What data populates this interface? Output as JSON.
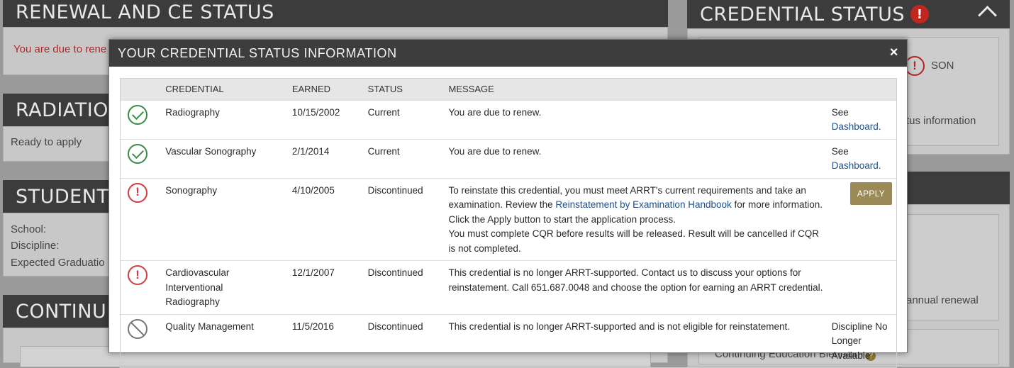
{
  "background": {
    "renewal_title": "RENEWAL AND CE STATUS",
    "renewal_text": "You are due to rene",
    "radiation_title": "RADIATIO",
    "radiation_text": "Ready to apply",
    "student_title": "STUDENT",
    "student_school": "School:",
    "student_discipline": "Discipline:",
    "student_graduation": "Expected Graduatio",
    "continuing_title": "CONTINU",
    "credential_status_title": "CREDENTIAL STATUS",
    "credential_status_alert": "!",
    "right_son": "SON",
    "right_status_info": "tus information",
    "right_annual_renewal": "annual renewal",
    "right_ce_biennium": "Continuing Education Biennium"
  },
  "modal": {
    "title": "YOUR CREDENTIAL STATUS INFORMATION",
    "close": "×",
    "columns": [
      "CREDENTIAL",
      "EARNED",
      "STATUS",
      "MESSAGE"
    ],
    "rows": [
      {
        "icon": "check-circle-icon",
        "credential": "Radiography",
        "earned": "10/15/2002",
        "status": "Current",
        "message": "You are due to renew.",
        "action_prefix": "See ",
        "action_link": "Dashboard."
      },
      {
        "icon": "check-circle-icon",
        "credential": "Vascular Sonography",
        "earned": "2/1/2014",
        "status": "Current",
        "message": "You are due to renew.",
        "action_prefix": "See ",
        "action_link": "Dashboard."
      },
      {
        "icon": "alert-circle-icon",
        "credential": "Sonography",
        "earned": "4/10/2005",
        "status": "Discontinued",
        "message_part1": "To reinstate this credential, you must meet ARRT's current requirements and take an examination. Review the ",
        "message_link": "Reinstatement by Examination Handbook",
        "message_part2": " for more information. Click the Apply button to start the application process.",
        "message_part3": "You must complete CQR before results will be released. Result will be cancelled if CQR is not completed.",
        "action_button": "APPLY"
      },
      {
        "icon": "alert-circle-icon",
        "credential_line1": "Cardiovascular",
        "credential_line2": "Interventional",
        "credential_line3": "Radiography",
        "earned": "12/1/2007",
        "status": "Discontinued",
        "message": "This credential is no longer ARRT-supported. Contact us to discuss your options for reinstatement. Call 651.687.0048 and choose the option for earning an ARRT credential."
      },
      {
        "icon": "no-entry-circle-icon",
        "credential": "Quality Management",
        "earned": "11/5/2016",
        "status": "Discontinued",
        "message": "This credential is no longer ARRT-supported and is not eligible for reinstatement.",
        "action_line1": "Discipline No",
        "action_line2": "Longer Available"
      }
    ]
  },
  "colors": {
    "header_bg": "#3d3d3d",
    "check_green": "#3a8a48",
    "alert_red": "#d23c3c",
    "apply_button": "#9b8a56",
    "link_blue": "#1f4e8c"
  }
}
